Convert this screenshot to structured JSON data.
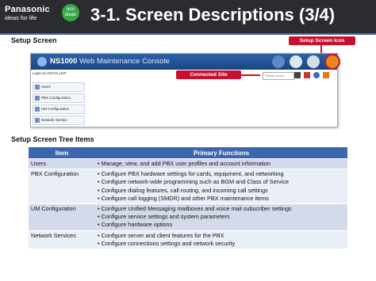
{
  "header": {
    "brand": "Panasonic",
    "tagline": "ideas for life",
    "eco_line1": "eco",
    "eco_line2": "ideas",
    "title": "3-1. Screen Descriptions (3/4)"
  },
  "setup_screen": {
    "heading": "Setup Screen",
    "callout_icon": "Setup Screen Icon",
    "callout_connected": "Connected Site",
    "console": {
      "product": "NS1000",
      "subtitle": "Web Maintenance Console",
      "login_text": "Login as INSTALLER",
      "site_select_value": "Please select",
      "tree_items": [
        "Users",
        "PBX Configuration",
        "UM Configuration",
        "Network Service"
      ],
      "icons": [
        "home-icon",
        "tools-icon",
        "gear-icon",
        "setup-icon"
      ]
    }
  },
  "tree_items_section": {
    "heading": "Setup Screen Tree Items",
    "columns": [
      "Item",
      "Primary Functions"
    ],
    "rows": [
      {
        "item": "Users",
        "functions": [
          "Manage, view, and add PBX user profiles and account information"
        ]
      },
      {
        "item": "PBX Configuration",
        "functions": [
          "Configure PBX hardware settings for cards, equipment, and networking",
          "Configure network-wide programming such as BGM and Class of Service",
          "Configure dialing features, call routing, and incoming call settings",
          "Configure call logging (SMDR) and other PBX maintenance items"
        ]
      },
      {
        "item": "UM Configuration",
        "functions": [
          "Configure Unified Messaging mailboxes and voice mail subscriber settings",
          "Configure service settings and system parameters",
          "Configure hardware options"
        ]
      },
      {
        "item": "Network Services",
        "functions": [
          "Configure server and client features for the PBX",
          "Configure connections settings and network security"
        ]
      }
    ]
  },
  "colors": {
    "header_bg": "#2a2c30",
    "accent_blue": "#3b66ad",
    "callout_red": "#c8102e",
    "eco_green": "#3aa64a"
  }
}
